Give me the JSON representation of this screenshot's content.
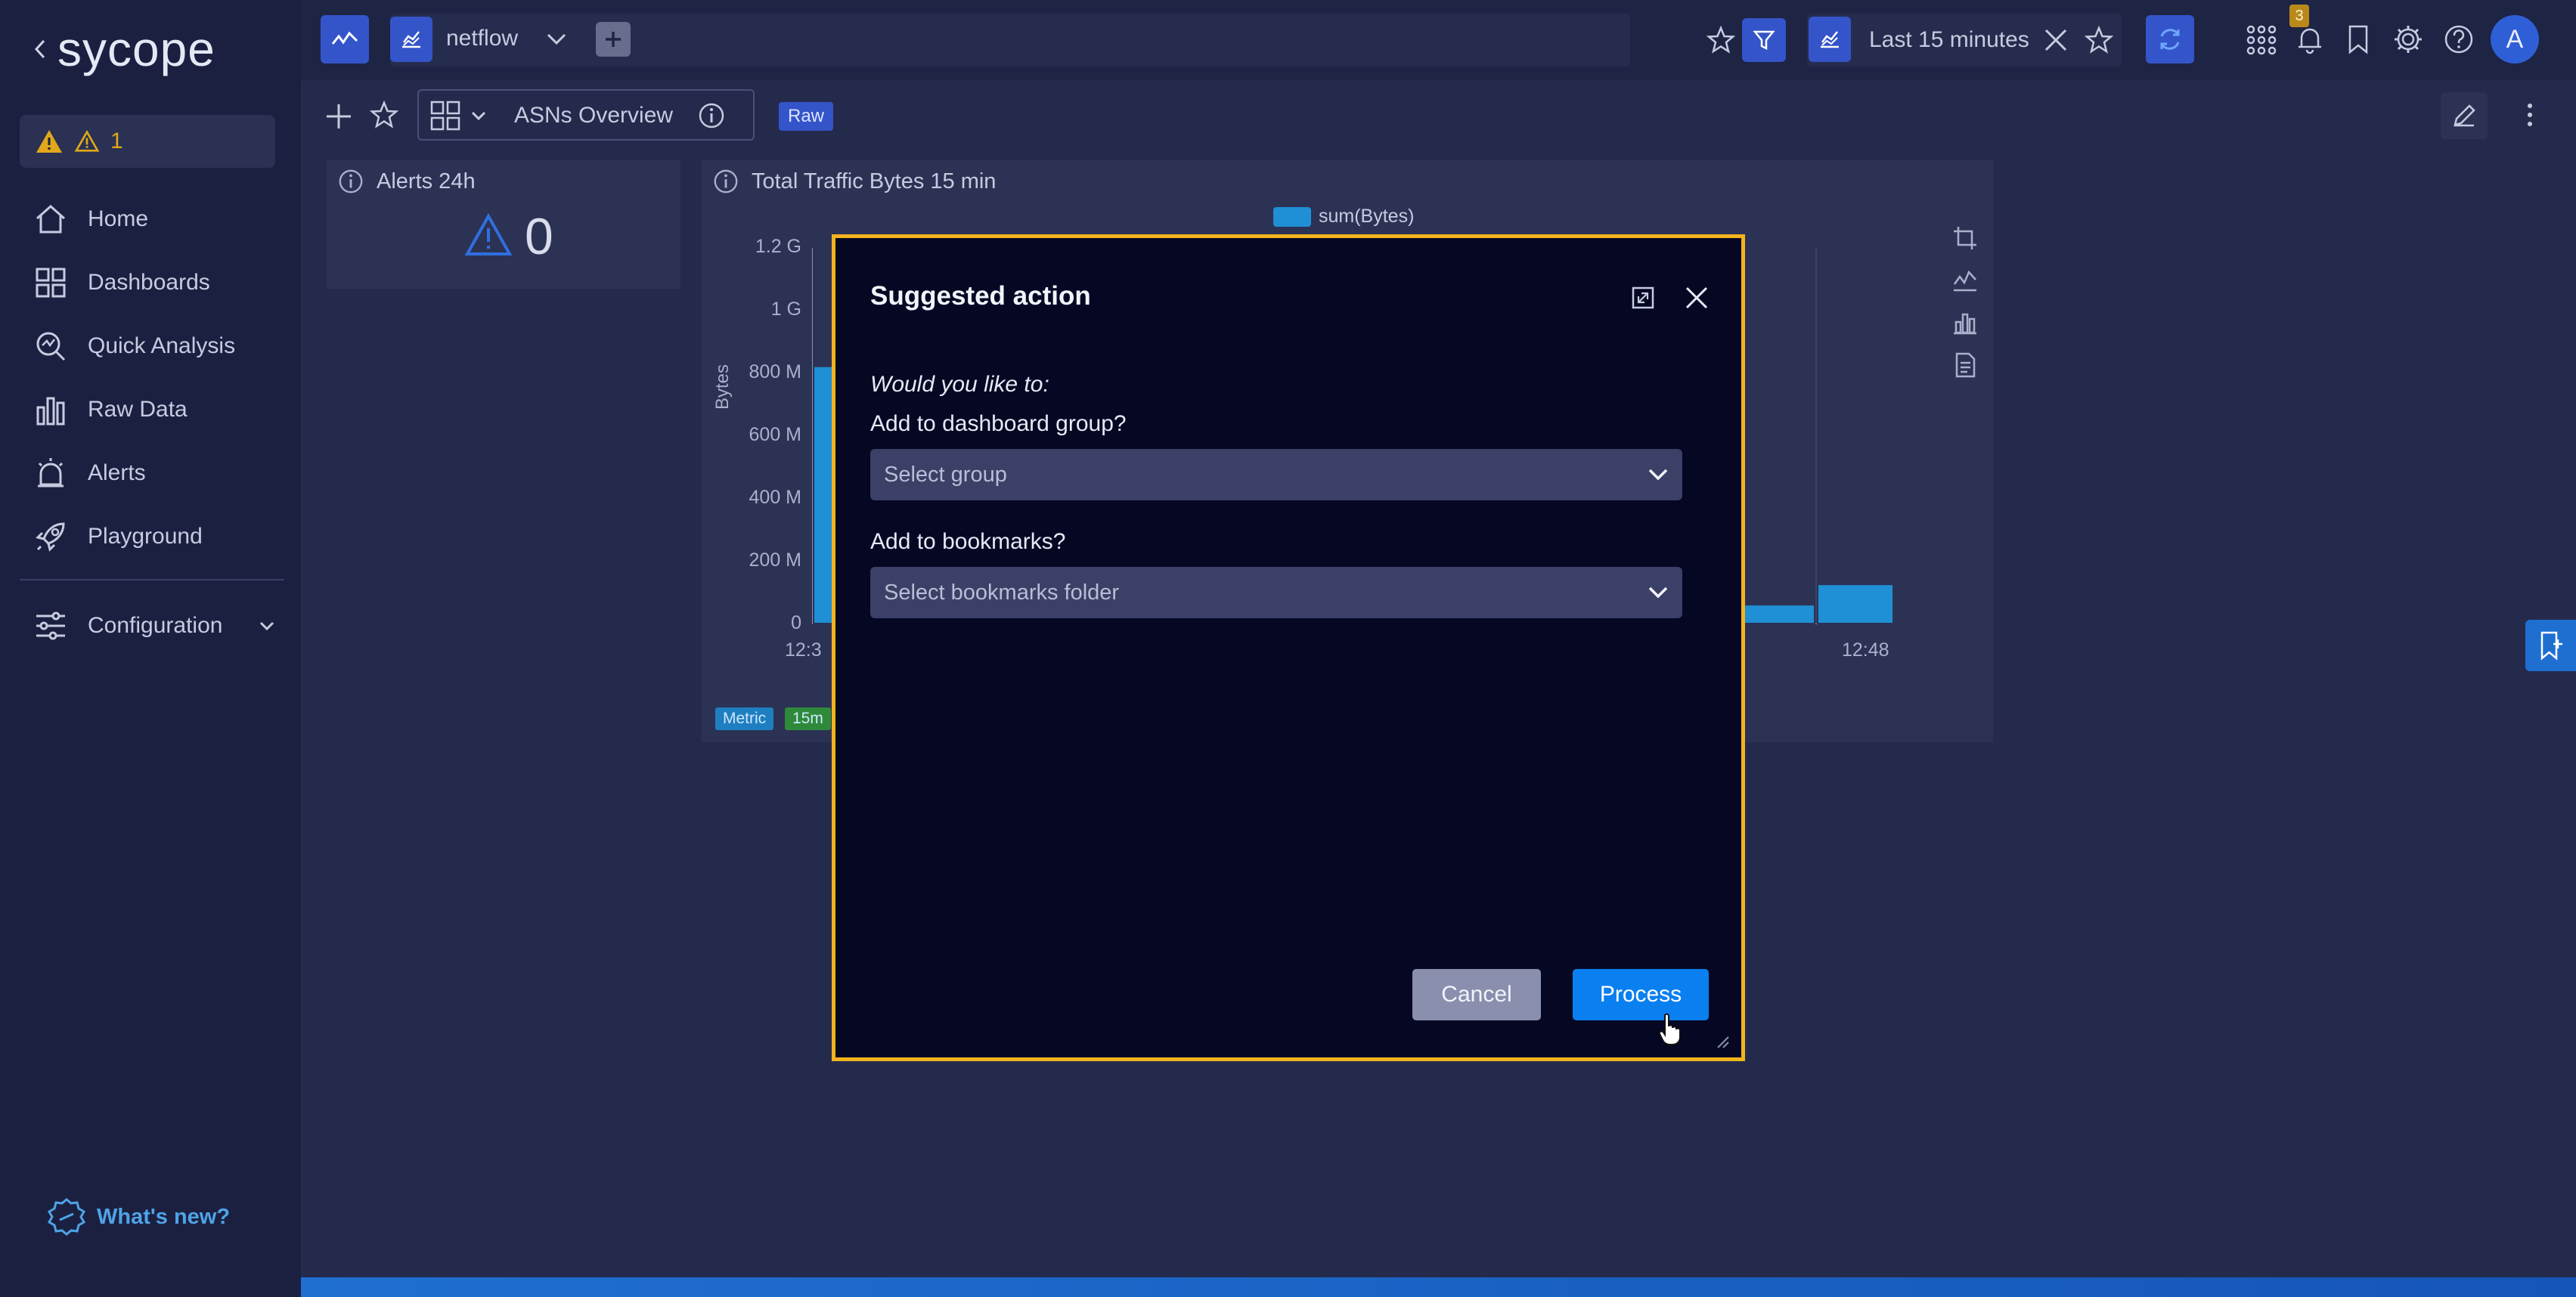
{
  "brand": {
    "logo_text": "sycope"
  },
  "sidebar": {
    "alert_count": "1",
    "items": [
      {
        "label": "Home"
      },
      {
        "label": "Dashboards"
      },
      {
        "label": "Quick Analysis"
      },
      {
        "label": "Raw Data"
      },
      {
        "label": "Alerts"
      },
      {
        "label": "Playground"
      }
    ],
    "configuration_label": "Configuration",
    "whats_new_label": "What's new?"
  },
  "topbar": {
    "source_label": "netflow",
    "time_range_label": "Last 15 minutes",
    "notification_badge": "3",
    "avatar_letter": "A"
  },
  "dashboard": {
    "name": "ASNs Overview",
    "raw_badge": "Raw"
  },
  "alerts_panel": {
    "title": "Alerts 24h",
    "value": "0"
  },
  "traffic_panel": {
    "title": "Total Traffic Bytes 15 min",
    "tags": [
      "Metric",
      "15m"
    ]
  },
  "chart_data": {
    "type": "bar",
    "title": "Total Traffic Bytes 15 min",
    "legend": [
      "sum(Bytes)"
    ],
    "legend_position": "top-center",
    "ylabel": "Bytes",
    "yticks": [
      "1.2 G",
      "1 G",
      "800 M",
      "600 M",
      "400 M",
      "200 M",
      "0"
    ],
    "ylim": [
      0,
      1200000000
    ],
    "xticks": [
      "12:3",
      "12:48"
    ],
    "visible_bars": [
      {
        "position": "first",
        "value": 820000000
      },
      {
        "position": "late",
        "value": 60000000
      },
      {
        "position": "late",
        "value": 55000000
      },
      {
        "position": "last",
        "value": 125000000
      }
    ],
    "color": "#1f8fd6"
  },
  "modal": {
    "title": "Suggested action",
    "prompt": "Would you like to:",
    "group_question": "Add to dashboard group?",
    "group_placeholder": "Select group",
    "bookmarks_question": "Add to bookmarks?",
    "bookmarks_placeholder": "Select bookmarks folder",
    "cancel_label": "Cancel",
    "process_label": "Process"
  }
}
